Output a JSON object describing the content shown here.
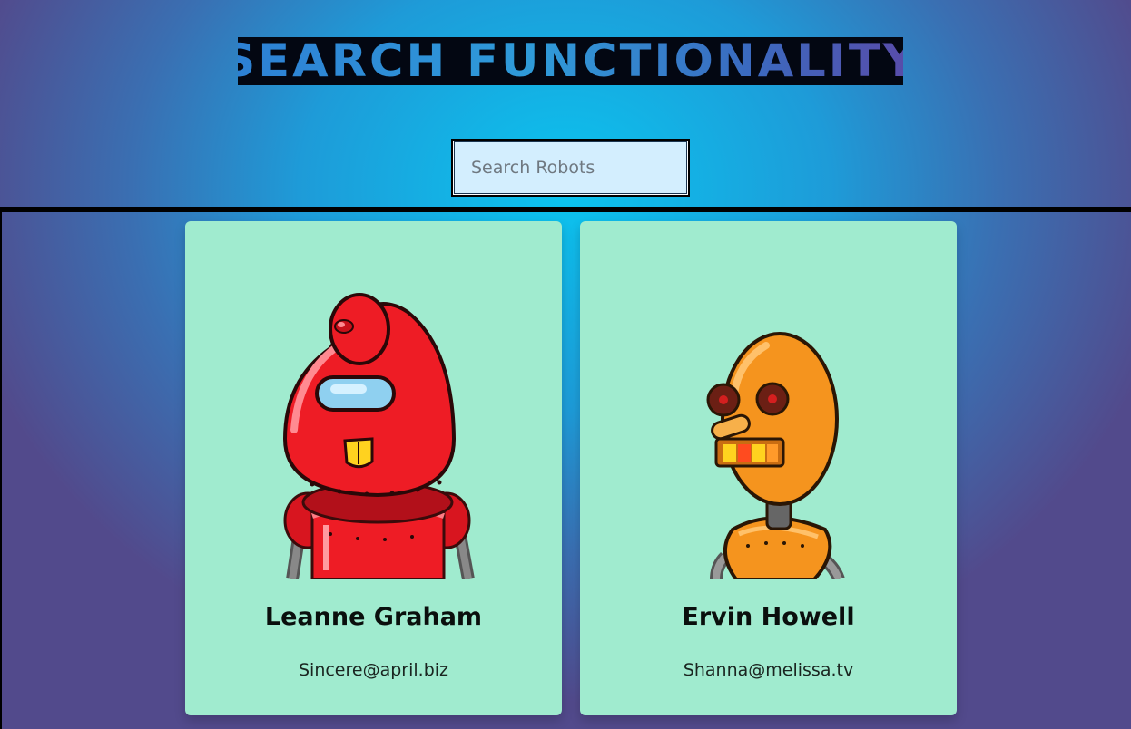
{
  "header": {
    "title": "SEARCH FUNCTIONALITY"
  },
  "search": {
    "placeholder": "Search Robots",
    "value": ""
  },
  "robots": [
    {
      "name": "Leanne Graham",
      "email": "Sincere@april.biz",
      "avatar_icon": "red-robot-avatar",
      "color": "#ee1c25"
    },
    {
      "name": "Ervin Howell",
      "email": "Shanna@melissa.tv",
      "avatar_icon": "orange-robot-avatar",
      "color": "#f5941e"
    }
  ],
  "colors": {
    "card_background": "#a0ebcf",
    "search_background": "#d3eefe",
    "title_background": "#030712"
  }
}
